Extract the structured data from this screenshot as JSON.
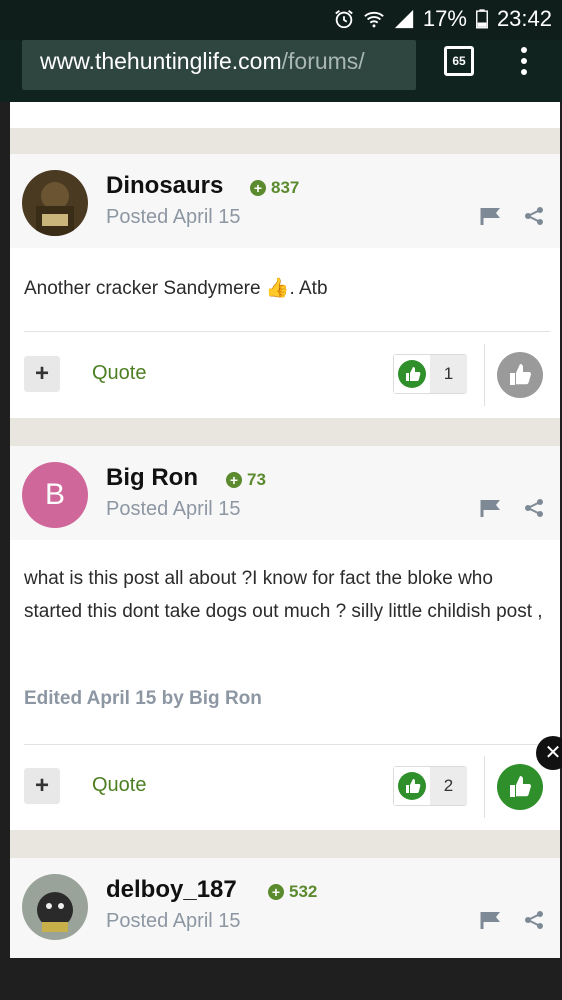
{
  "status_bar": {
    "battery": "17%",
    "time": "23:42"
  },
  "browser": {
    "url_domain": "www.thehuntinglife.com",
    "url_path": "/forums/",
    "tab_count": "65"
  },
  "posts": [
    {
      "author": "Dinosaurs",
      "reputation": "837",
      "posted": "Posted April 15",
      "text": "Another cracker Sandymere 👍. Atb",
      "quote_label": "Quote",
      "like_count": "1",
      "liked": false
    },
    {
      "author": "Big Ron",
      "avatar_letter": "B",
      "reputation": "73",
      "posted": "Posted April 15",
      "text": "what is this  post all about ?I know for fact  the bloke who started this dont take dogs out much ? silly little childish post  ,",
      "edited": "Edited April 15 by Big Ron",
      "quote_label": "Quote",
      "like_count": "2",
      "liked": true
    },
    {
      "author": "delboy_187",
      "reputation": "532",
      "posted": "Posted April 15"
    }
  ],
  "colors": {
    "accent_green": "#4d7f23",
    "rep_green": "#5b8a2f",
    "like_green": "#2f8f2a",
    "like_gray": "#9a9a9a",
    "toolbar": "#10231f"
  },
  "icons": [
    "alarm-icon",
    "wifi-icon",
    "signal-icon",
    "battery-icon",
    "flag-icon",
    "share-icon",
    "thumbs-up-icon",
    "close-icon"
  ]
}
